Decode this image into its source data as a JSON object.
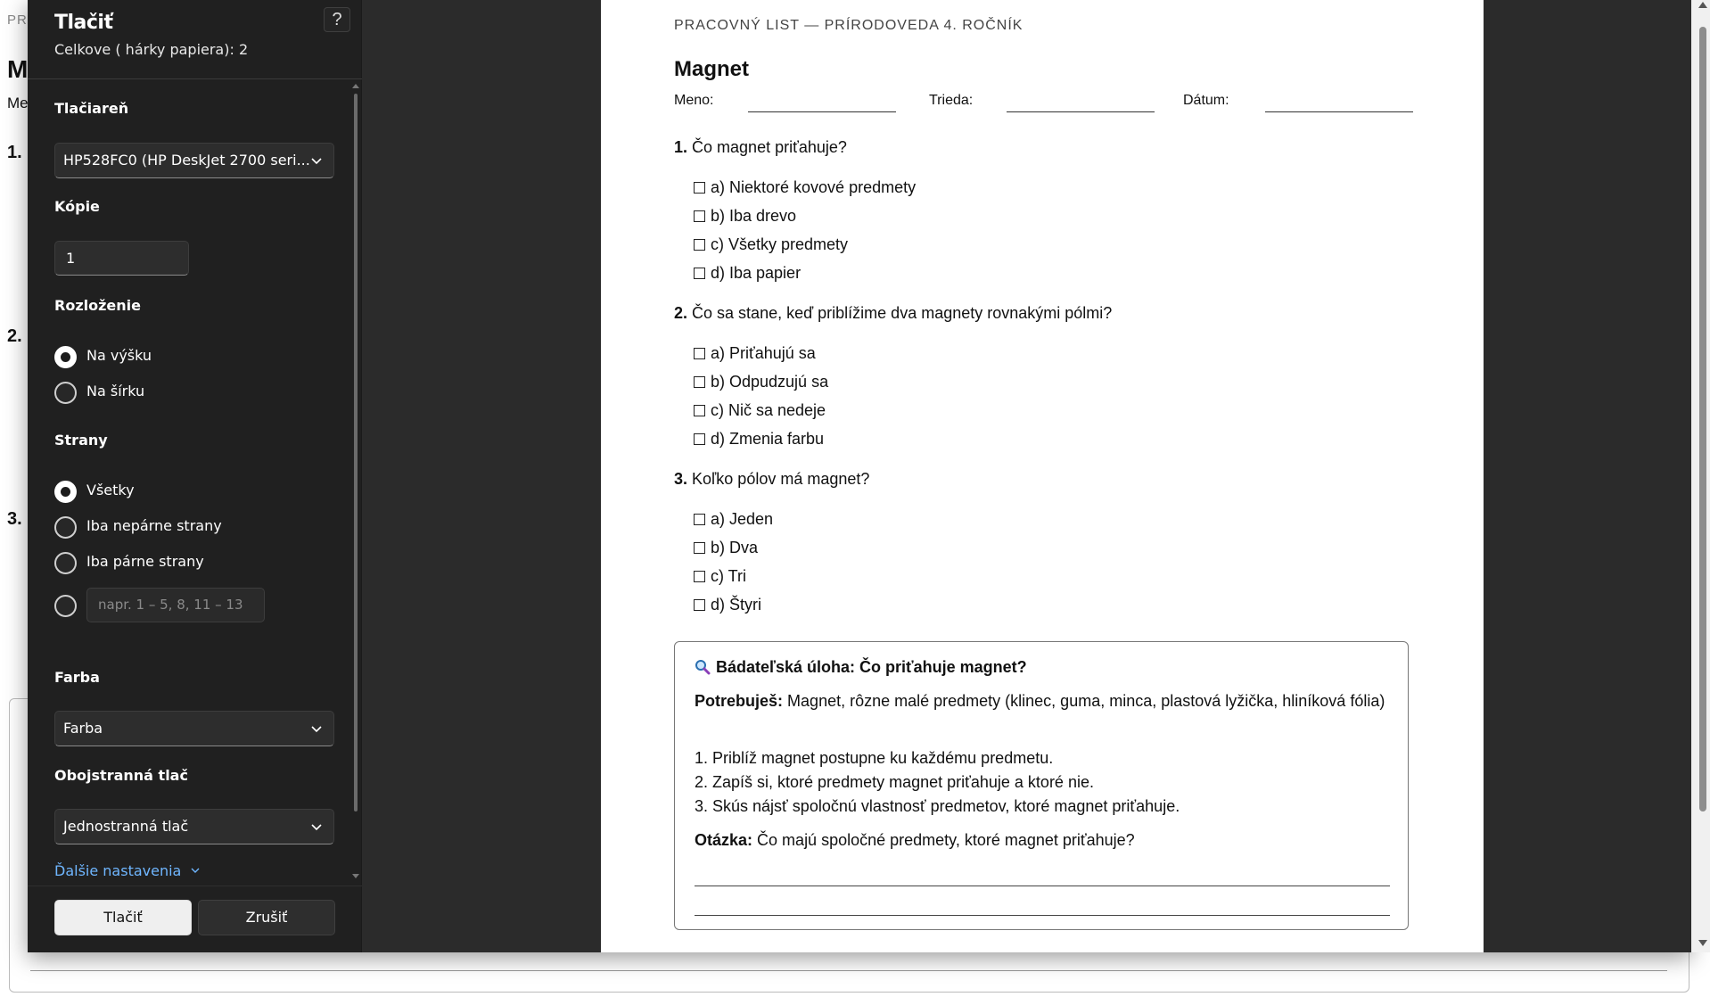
{
  "background_page": {
    "header_fragment": "PR",
    "title_fragment": "M",
    "sub_fragment": "Me",
    "question_numbers": [
      "1.",
      "2.",
      "3."
    ]
  },
  "dialog": {
    "title": "Tlačiť",
    "help": "?",
    "sheet_count": "Celkove ( hárky papiera): 2",
    "printer": {
      "label": "Tlačiareň",
      "value": "HP528FC0 (HP DeskJet 2700 seri..."
    },
    "copies": {
      "label": "Kópie",
      "value": "1"
    },
    "layout": {
      "label": "Rozloženie",
      "options": [
        {
          "label": "Na výšku",
          "selected": true
        },
        {
          "label": "Na šírku",
          "selected": false
        }
      ]
    },
    "pages": {
      "label": "Strany",
      "options": [
        {
          "label": "Všetky",
          "selected": true
        },
        {
          "label": "Iba nepárne strany",
          "selected": false
        },
        {
          "label": "Iba párne strany",
          "selected": false
        }
      ],
      "custom_placeholder": "napr. 1 – 5, 8, 11 – 13"
    },
    "color": {
      "label": "Farba",
      "value": "Farba"
    },
    "duplex": {
      "label": "Obojstranná tlač",
      "value": "Jednostranná tlač"
    },
    "more_settings": "Ďalšie nastavenia",
    "print_button": "Tlačiť",
    "cancel_button": "Zrušiť"
  },
  "worksheet": {
    "header": "PRACOVNÝ LIST — PRÍRODOVEDA 4. ROČNÍK",
    "title": "Magnet",
    "fields": [
      "Meno:",
      "Trieda:",
      "Dátum:"
    ],
    "questions": [
      {
        "number": "1.",
        "text": "Čo magnet priťahuje?",
        "options": [
          "a) Niektoré kovové predmety",
          "b) Iba drevo",
          "c) Všetky predmety",
          "d) Iba papier"
        ]
      },
      {
        "number": "2.",
        "text": "Čo sa stane, keď priblížime dva magnety rovnakými pólmi?",
        "options": [
          "a) Priťahujú sa",
          "b) Odpudzujú sa",
          "c) Nič sa nedeje",
          "d) Zmenia farbu"
        ]
      },
      {
        "number": "3.",
        "text": "Koľko pólov má magnet?",
        "options": [
          "a) Jeden",
          "b) Dva",
          "c) Tri",
          "d) Štyri"
        ]
      }
    ],
    "task": {
      "icon": "magnifier-icon",
      "title": "Bádateľská úloha: Čo priťahuje magnet?",
      "needs_label": "Potrebuješ:",
      "needs_text": "Magnet, rôzne malé predmety (klinec, guma, minca, plastová lyžička, hliníková fólia)",
      "steps": [
        "1. Priblíž magnet postupne ku každému predmetu.",
        "2. Zapíš si, ktoré predmety magnet priťahuje a ktoré nie.",
        "3. Skús nájsť spoločnú vlastnosť predmetov, ktoré magnet priťahuje."
      ],
      "question_label": "Otázka:",
      "question_text": "Čo majú spoločné predmety, ktoré magnet priťahuje?"
    }
  }
}
